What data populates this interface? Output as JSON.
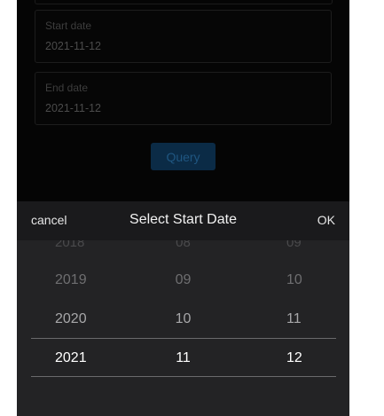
{
  "form": {
    "start_date": {
      "label": "Start date",
      "value": "2021-11-12"
    },
    "end_date": {
      "label": "End date",
      "value": "2021-11-12"
    },
    "query_label": "Query"
  },
  "picker": {
    "cancel_label": "cancel",
    "title": "Select Start Date",
    "ok_label": "OK",
    "years": [
      "2018",
      "2019",
      "2020",
      "2021"
    ],
    "months": [
      "08",
      "09",
      "10",
      "11"
    ],
    "days": [
      "09",
      "10",
      "11",
      "12"
    ],
    "selected": {
      "year": "2021",
      "month": "11",
      "day": "12"
    }
  }
}
